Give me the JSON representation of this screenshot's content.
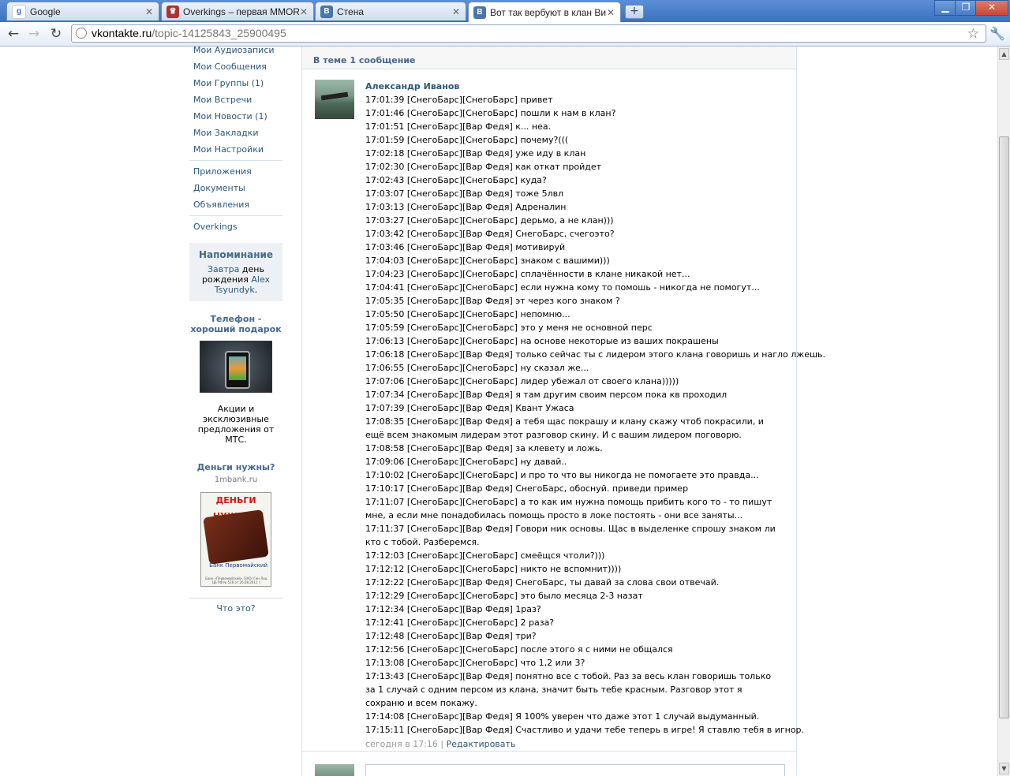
{
  "browser": {
    "tabs": [
      {
        "title": "Google",
        "favicon": "google-icon",
        "active": false
      },
      {
        "title": "Overkings – первая MMORPG",
        "favicon": "overkings-icon",
        "active": false
      },
      {
        "title": "Стена",
        "favicon": "vk-icon",
        "active": false
      },
      {
        "title": "Вот так вербуют в клан Вит",
        "favicon": "vk-icon",
        "active": true
      }
    ],
    "url_host": "vkontakte.ru",
    "url_path": "/topic-14125843_25900495"
  },
  "left_menu": {
    "items_top": [
      "Мои Аудиозаписи",
      "Мои Сообщения",
      "Мои Группы (1)",
      "Мои Встречи",
      "Мои Новости (1)",
      "Мои Закладки",
      "Мои Настройки"
    ],
    "items_mid": [
      "Приложения",
      "Документы",
      "Объявления"
    ],
    "items_bottom": [
      "Overkings"
    ]
  },
  "reminder": {
    "title": "Напоминание",
    "tomorrow": "Завтра",
    "text": "день рождения",
    "person": "Alex Tsyundyk",
    "dot": "."
  },
  "ads": [
    {
      "title": "Телефон - хороший подарок",
      "text": "Акции и эксклюзивные предложения от МТС."
    },
    {
      "title": "Деньги нужны?",
      "domain": "1mbank.ru",
      "banner_head": "ДЕНЬГИ НУЖНЫ?",
      "bank_name": "Банк Первомайский",
      "fine_print": "Банк «Первомайский» (ЗАО) Ген.Лиц. ЦБ РФ № 518 от 26.08.2011 г."
    }
  ],
  "whatis": "Что это?",
  "topic": {
    "count_label": "В теме 1 сообщение",
    "author": "Александр Иванов",
    "lines": [
      "17:01:39 [СнегоБарс][СнегоБарс] привет",
      "17:01:46 [СнегоБарс][СнегоБарс] пошли к нам в клан?",
      "17:01:51 [СнегоБарс][Вар Федя] к... неа.",
      "17:01:59 [СнегоБарс][СнегоБарс] почему?(((",
      "17:02:18 [СнегоБарс][Вар Федя] уже иду в клан",
      "17:02:30 [СнегоБарс][Вар Федя] как откат пройдет",
      "17:02:43 [СнегоБарс][СнегоБарс] куда?",
      "17:03:07 [СнегоБарс][Вар Федя] тоже 5лвл",
      "17:03:13 [СнегоБарс][Вар Федя] Адреналин",
      "17:03:27 [СнегоБарс][СнегоБарс] дерьмо, а не клан)))",
      "17:03:42 [СнегоБарс][Вар Федя] СнегоБарс, счегоэто?",
      "17:03:46 [СнегоБарс][Вар Федя] мотивируй",
      "17:04:03 [СнегоБарс][СнегоБарс] знаком с вашими)))",
      "17:04:23 [СнегоБарс][СнегоБарс] сплачённости в клане никакой нет...",
      "17:04:41 [СнегоБарс][СнегоБарс] если нужна кому то помошь - никогда не помогут...",
      "17:05:35 [СнегоБарс][Вар Федя] эт через кого знаком ?",
      "17:05:50 [СнегоБарс][СнегоБарс] непомню...",
      "17:05:59 [СнегоБарс][СнегоБарс] это у меня не основной перс",
      "17:06:13 [СнегоБарс][СнегоБарс] на основе некоторые из ваших покрашены",
      "17:06:18 [СнегоБарс][Вар Федя] только сейчас ты с лидером этого клана говоришь и нагло лжешь.",
      "17:06:55 [СнегоБарс][СнегоБарс] ну сказал же...",
      "17:07:06 [СнегоБарс][СнегоБарс] лидер убежал от своего клана)))))",
      "17:07:34 [СнегоБарс][Вар Федя] я там другим своим персом пока кв проходил",
      "17:07:39 [СнегоБарс][Вар Федя] Квант Ужаса",
      "17:08:35 [СнегоБарс][Вар Федя] а тебя щас покрашу и клану скажу чтоб покрасили, и ещё всем знакомым лидерам этот разговор скину. И с вашим лидером поговорю.",
      "17:08:58 [СнегоБарс][Вар Федя] за клевету и ложь.",
      "17:09:06 [СнегоБарс][СнегоБарс] ну давай..",
      "17:10:02 [СнегоБарс][СнегоБарс] и про то что вы никогда не помогаете это правда...",
      "17:10:17 [СнегоБарс][Вар Федя] СнегоБарс, обоснуй. приведи пример",
      "17:11:07 [СнегоБарс][СнегоБарс] а то как им нужна помощь прибить кого то - то пишут мне, а если мне понадобилась помощь просто в локе постоять - они все заняты...",
      "17:11:37 [СнегоБарс][Вар Федя] Говори ник основы. Щас в выделенке спрошу знаком ли кто с тобой. Разберемся.",
      "17:12:03 [СнегоБарс][СнегоБарс] смеёщся чтоли?)))",
      "17:12:12 [СнегоБарс][СнегоБарс] никто не вспомнит))))",
      "17:12:22 [СнегоБарс][Вар Федя] СнегоБарс, ты давай за слова свои отвечай.",
      "17:12:29 [СнегоБарс][СнегоБарс] это было месяца 2-3 назат",
      "17:12:34 [СнегоБарс][Вар Федя] 1раз?",
      "17:12:41 [СнегоБарс][СнегоБарс] 2 раза?",
      "17:12:48 [СнегоБарс][Вар Федя] три?",
      "17:12:56 [СнегоБарс][СнегоБарс] после этого я с ними не общался",
      "17:13:08 [СнегоБарс][СнегоБарс] что 1,2 или 3?",
      "17:13:43 [СнегоБарс][Вар Федя] понятно все с тобой. Раз за весь клан говоришь только за 1 случай с одним персом из клана, значит быть тебе красным. Разговор этот я сохраню и всем покажу.",
      "17:14:08 [СнегоБарс][Вар Федя] Я 100% уверен что даже этот 1 случай выдуманный.",
      "17:15:11 [СнегоБарс][Вар Федя] Счастливо и удачи тебе теперь в игре! Я ставлю тебя в игнор."
    ],
    "timestamp": "сегодня в 17:16",
    "meta_sep": "|",
    "edit_link": "Редактировать"
  }
}
